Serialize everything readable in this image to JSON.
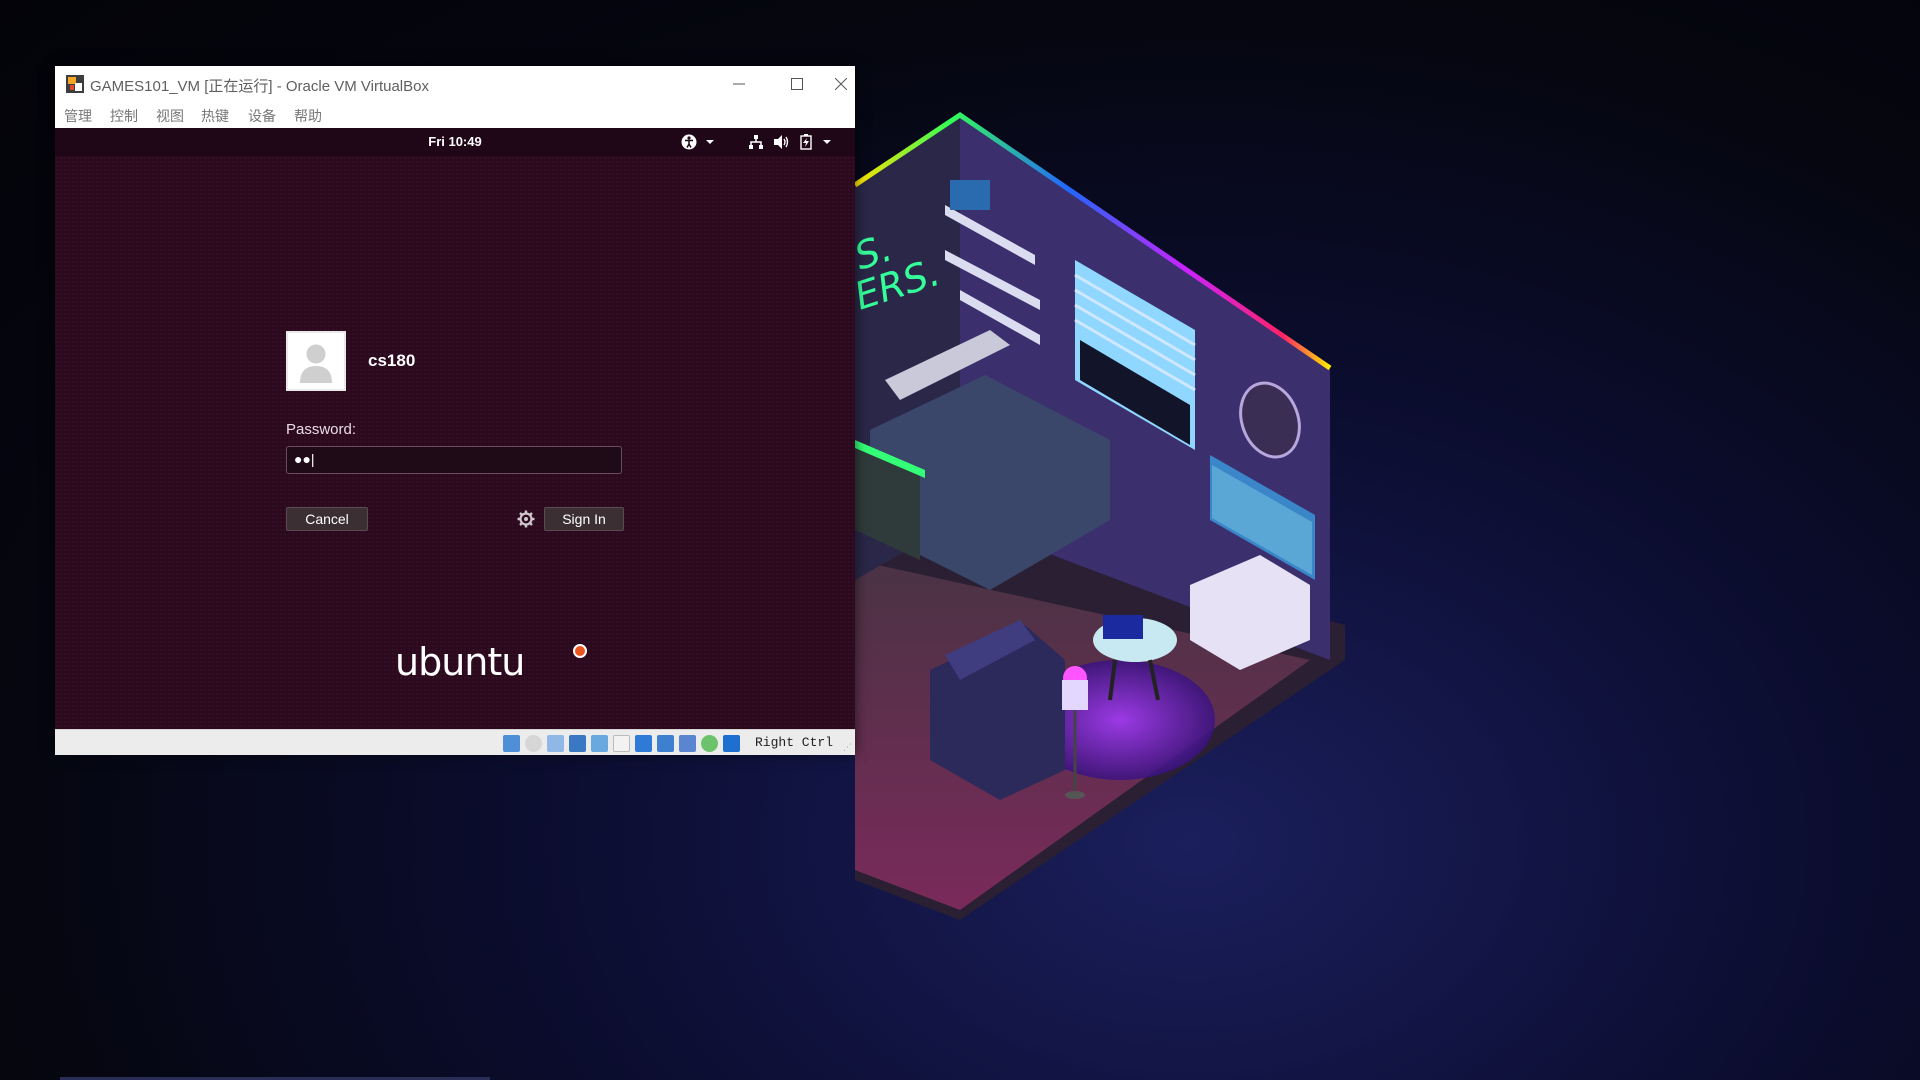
{
  "window": {
    "title": "GAMES101_VM [正在运行] - Oracle VM VirtualBox",
    "menu": [
      "管理",
      "控制",
      "视图",
      "热键",
      "设备",
      "帮助"
    ]
  },
  "guest": {
    "topbar": {
      "clock": "Fri 10:49"
    },
    "login": {
      "username": "cs180",
      "password_label": "Password:",
      "password_value": "●●|",
      "cancel_label": "Cancel",
      "signin_label": "Sign In"
    },
    "logo_text": "ubuntu"
  },
  "statusbar": {
    "host_key": "Right Ctrl"
  },
  "colors": {
    "ubuntu_orange": "#e95420",
    "guest_bg": "#2c0a1e"
  }
}
